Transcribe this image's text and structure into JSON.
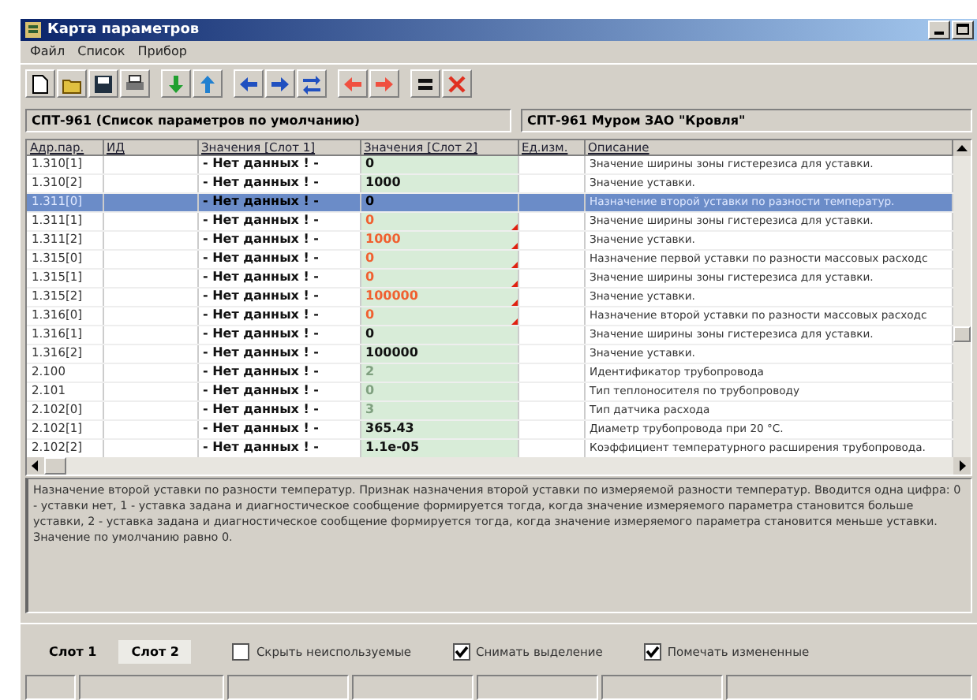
{
  "window": {
    "title": "Карта параметров"
  },
  "menu": [
    "Файл",
    "Список",
    "Прибор"
  ],
  "headers": [
    "СПТ-961 (Список параметров по умолчанию)",
    "СПТ-961 Муром ЗАО \"Кровля\""
  ],
  "table": {
    "columns": [
      "Адр.пар.",
      "ИД",
      "Значения [Слот 1]",
      "Значения [Слот 2]",
      "Ед.изм.",
      "Описание"
    ],
    "rows": [
      {
        "addr": "1.310[1]",
        "slot1": "- Нет данных ! -",
        "slot2": "0",
        "changed": false,
        "unused": false,
        "desc": "Значение ширины зоны гистерезиса для уставки.",
        "selected": false
      },
      {
        "addr": "1.310[2]",
        "slot1": "- Нет данных ! -",
        "slot2": "1000",
        "changed": false,
        "unused": false,
        "desc": "Значение уставки.",
        "selected": false
      },
      {
        "addr": "1.311[0]",
        "slot1": "- Нет данных ! -",
        "slot2": "0",
        "changed": false,
        "unused": false,
        "desc": "Назначение второй  уставки по разности температур.",
        "selected": true
      },
      {
        "addr": "1.311[1]",
        "slot1": "- Нет данных ! -",
        "slot2": "0",
        "changed": true,
        "unused": false,
        "desc": "Значение ширины зоны гистерезиса для уставки.",
        "selected": false
      },
      {
        "addr": "1.311[2]",
        "slot1": "- Нет данных ! -",
        "slot2": "1000",
        "changed": true,
        "unused": false,
        "desc": "Значение уставки.",
        "selected": false
      },
      {
        "addr": "1.315[0]",
        "slot1": "- Нет данных ! -",
        "slot2": "0",
        "changed": true,
        "unused": false,
        "desc": "Назначение первой уставки по разности массовых расходс",
        "selected": false
      },
      {
        "addr": "1.315[1]",
        "slot1": "- Нет данных ! -",
        "slot2": "0",
        "changed": true,
        "unused": false,
        "desc": "Значение ширины зоны гистерезиса для уставки.",
        "selected": false
      },
      {
        "addr": "1.315[2]",
        "slot1": "- Нет данных ! -",
        "slot2": "100000",
        "changed": true,
        "unused": false,
        "desc": "Значение уставки.",
        "selected": false
      },
      {
        "addr": "1.316[0]",
        "slot1": "- Нет данных ! -",
        "slot2": "0",
        "changed": true,
        "unused": false,
        "desc": "Назначение второй уставки по разности массовых расходс",
        "selected": false
      },
      {
        "addr": "1.316[1]",
        "slot1": "- Нет данных ! -",
        "slot2": "0",
        "changed": false,
        "unused": false,
        "desc": "Значение ширины зоны гистерезиса для уставки.",
        "selected": false
      },
      {
        "addr": "1.316[2]",
        "slot1": "- Нет данных ! -",
        "slot2": "100000",
        "changed": false,
        "unused": false,
        "desc": "Значение уставки.",
        "selected": false
      },
      {
        "addr": "2.100",
        "slot1": "- Нет данных ! -",
        "slot2": "2",
        "changed": false,
        "unused": true,
        "desc": "Идентификатор трубопровода",
        "selected": false
      },
      {
        "addr": "2.101",
        "slot1": "- Нет данных ! -",
        "slot2": "0",
        "changed": false,
        "unused": true,
        "desc": "Тип теплоносителя по трубопроводу",
        "selected": false
      },
      {
        "addr": "2.102[0]",
        "slot1": "- Нет данных ! -",
        "slot2": "3",
        "changed": false,
        "unused": true,
        "desc": "Тип датчика  расхода",
        "selected": false
      },
      {
        "addr": "2.102[1]",
        "slot1": "- Нет данных ! -",
        "slot2": "365.43",
        "changed": false,
        "unused": false,
        "desc": "Диаметр  трубопровода  при 20 °C.",
        "selected": false
      },
      {
        "addr": "2.102[2]",
        "slot1": "- Нет данных ! -",
        "slot2": "1.1e-05",
        "changed": false,
        "unused": false,
        "desc": "Коэффициент температурного расширения трубопровода.",
        "selected": false
      }
    ]
  },
  "description": "Назначение второй  уставки по разности температур.  Признак назначения второй  уставки по измеряемой разности температур. Вводится одна цифра: 0 - уставки нет, 1 - уставка  задана и диагностическое  сообщение формируется тогда,  когда  значение  измеряемого  параметра становится больше  уставки, 2 - уставка  задана и диагностическое  сообщение формируется тогда,  когда  значение  измеряемого  параметра становится меньше уставки. Значение по умолчанию равно 0.",
  "slots": [
    {
      "label": "Слот 1",
      "selected": false
    },
    {
      "label": "Слот 2",
      "selected": true
    }
  ],
  "options": [
    {
      "label": "Скрыть неиспользуемые",
      "checked": false
    },
    {
      "label": "Снимать выделение",
      "checked": true
    },
    {
      "label": "Помечать измененные",
      "checked": true
    }
  ]
}
